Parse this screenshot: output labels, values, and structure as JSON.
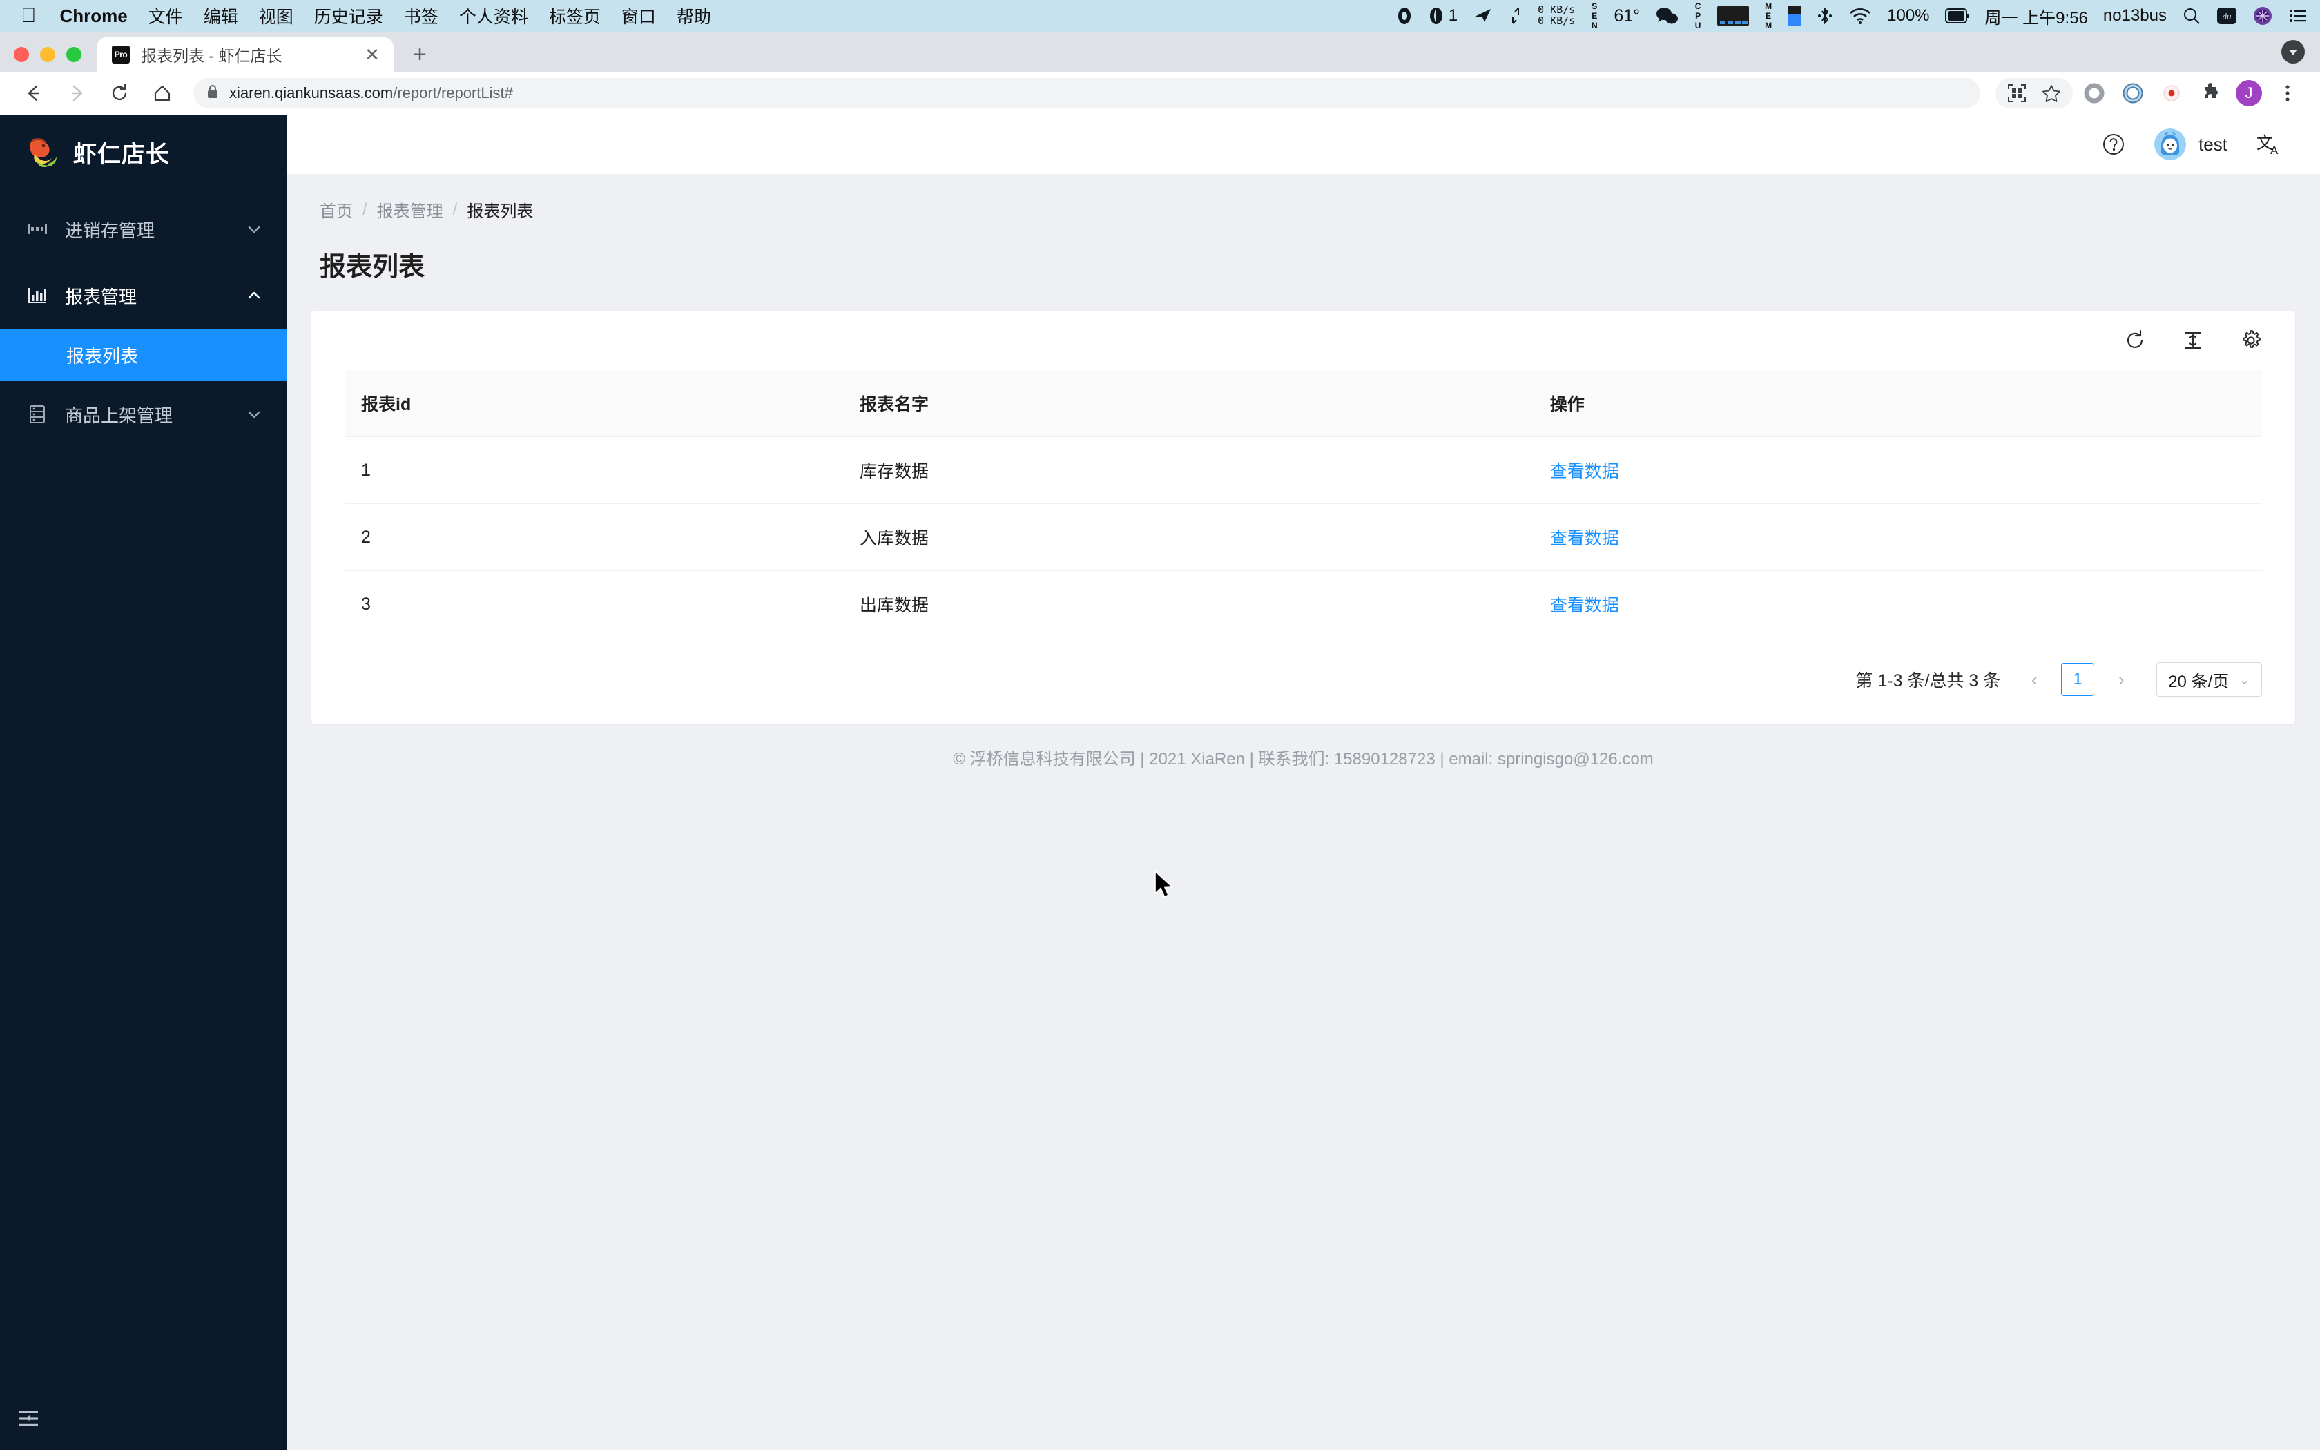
{
  "mac_menubar": {
    "apple_icon": "apple-logo",
    "app_name": "Chrome",
    "menus": [
      "文件",
      "编辑",
      "视图",
      "历史记录",
      "书签",
      "个人资料",
      "标签页",
      "窗口",
      "帮助"
    ],
    "status": {
      "notification_count": "1",
      "net_up": "0 KB/s",
      "net_down": "0 KB/s",
      "sensor_label": "SEN",
      "temperature": "61°",
      "cpu_label": "CPU",
      "mem_label": "MEM",
      "battery_percent": "100%",
      "clock": "周一 上午9:56",
      "wifi_name": "no13bus"
    }
  },
  "browser": {
    "tab": {
      "favicon_text": "Pro",
      "title": "报表列表 - 虾仁店长",
      "close_glyph": "✕"
    },
    "new_tab_glyph": "+",
    "omnibox": {
      "url_secure": "xiaren.qiankunsaas.com",
      "url_path": "/report/reportList#",
      "full_url": "xiaren.qiankunsaas.com/report/reportList#"
    },
    "profile_initial": "J"
  },
  "sidebar": {
    "brand_name": "虾仁店长",
    "brand_logo_icon": "shrimp-logo",
    "items": [
      {
        "label": "进销存管理",
        "icon": "inventory-icon",
        "expanded": false,
        "arrow": "chevron-down"
      },
      {
        "label": "报表管理",
        "icon": "bar-chart-icon",
        "expanded": true,
        "arrow": "chevron-up"
      }
    ],
    "sub_items": [
      {
        "label": "报表列表",
        "active": true
      }
    ],
    "last_item": {
      "label": "商品上架管理",
      "icon": "list-icon",
      "expanded": false,
      "arrow": "chevron-down"
    },
    "collapse_icon": "menu-fold-icon",
    "active_color": "#1890ff",
    "background_color": "#0b1a2b"
  },
  "topbar": {
    "help_icon": "question-circle-icon",
    "user_name": "test",
    "avatar_icon": "user-avatar",
    "language_icon": "translate-icon"
  },
  "page": {
    "breadcrumb": [
      "首页",
      "报表管理",
      "报表列表"
    ],
    "breadcrumb_separator": "/",
    "title": "报表列表"
  },
  "table_card": {
    "toolbar_icons": [
      "refresh-icon",
      "row-density-icon",
      "settings-gear-icon"
    ],
    "columns": [
      "报表id",
      "报表名字",
      "操作"
    ],
    "rows": [
      {
        "id": "1",
        "name": "库存数据",
        "action": "查看数据"
      },
      {
        "id": "2",
        "name": "入库数据",
        "action": "查看数据"
      },
      {
        "id": "3",
        "name": "出库数据",
        "action": "查看数据"
      }
    ],
    "pagination": {
      "summary": "第 1-3 条/总共 3 条",
      "prev_glyph": "‹",
      "current_page": "1",
      "next_glyph": "›",
      "page_size": "20 条/页",
      "caret_glyph": "⌄"
    }
  },
  "footer": {
    "text": "© 浮桥信息科技有限公司 | 2021 XiaRen | 联系我们: 15890128723 | email: springisgo@126.com"
  }
}
